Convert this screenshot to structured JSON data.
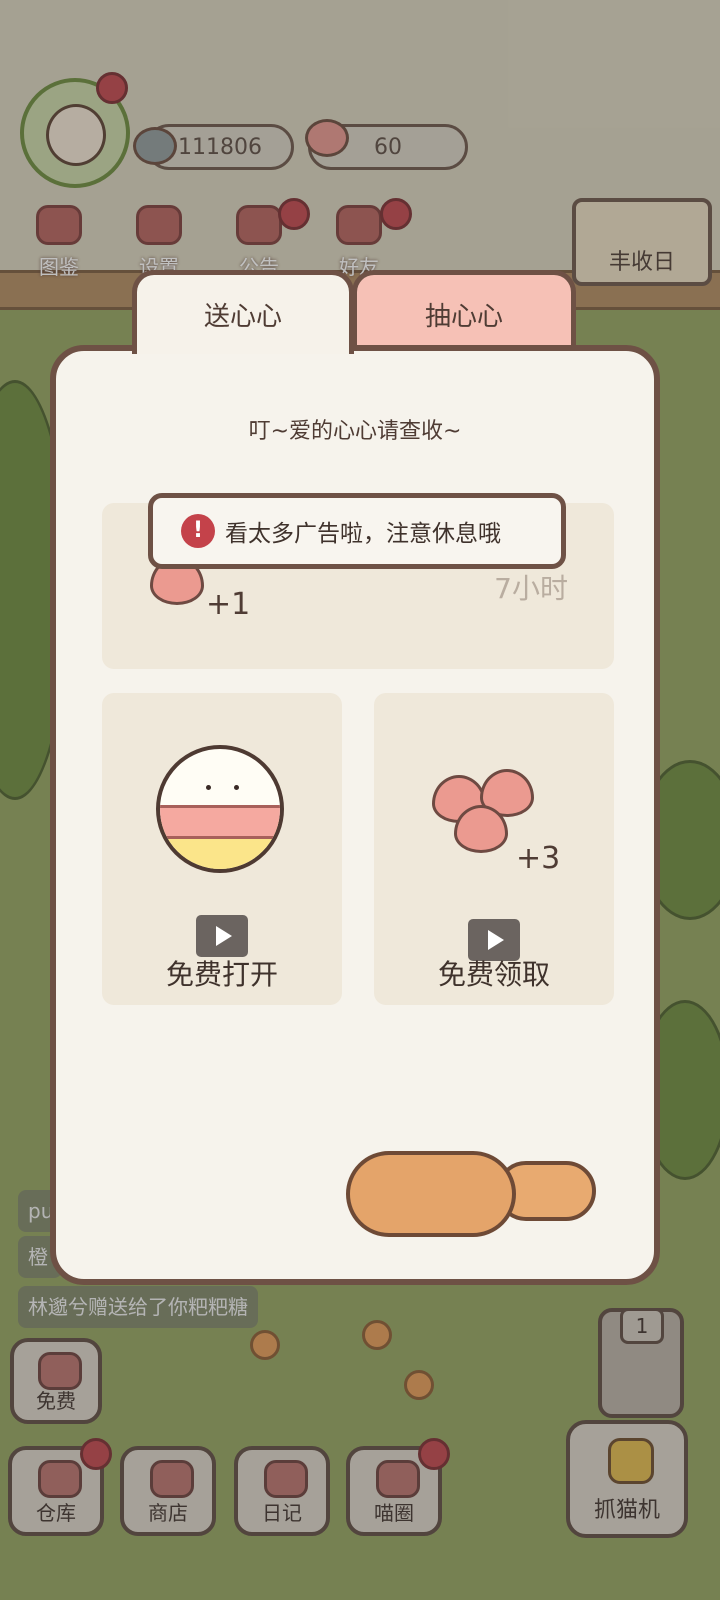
{
  "hud": {
    "coins": "111806",
    "hearts": "60",
    "menu": [
      "图鉴",
      "设置",
      "公告",
      "好友"
    ],
    "harvest_label": "丰收日"
  },
  "chat": {
    "lines": [
      "pu",
      "橙",
      "林邈兮赠送给了你粑粑糖"
    ]
  },
  "bottom": {
    "free": "免费",
    "warehouse": "仓库",
    "shop": "商店",
    "diary": "日记",
    "catcircle": "喵圈",
    "claw": "抓猫机",
    "machine_count": "1"
  },
  "modal": {
    "tabs": [
      "送心心",
      "抽心心"
    ],
    "subtitle": "叮~爱的心心请查收~",
    "top_card": {
      "plus": "+1",
      "timer": "7小时"
    },
    "left_card": {
      "label": "免费打开"
    },
    "right_card": {
      "plus": "+3",
      "label": "免费领取"
    }
  },
  "toast": {
    "icon": "!",
    "text": "看太多广告啦，注意休息哦"
  },
  "colors": {
    "modal_border": "#6e5145",
    "tab_inactive": "#f6c1b6",
    "card_bg": "#efe8da",
    "alert_red": "#c4424a"
  }
}
